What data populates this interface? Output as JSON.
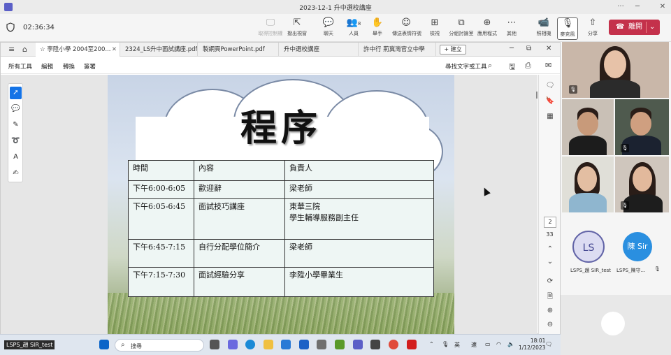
{
  "window": {
    "title": "2023-12-1 升中選校講座",
    "min": "─",
    "restore": "⧉",
    "max": "□",
    "close": "✕"
  },
  "meeting": {
    "timer": "02:36:34",
    "toolbar": [
      {
        "key": "remote_control",
        "label": "取得控制權",
        "icon": "🖵",
        "dim": true
      },
      {
        "key": "stop_present",
        "label": "撥出視窗",
        "icon": "⇱"
      },
      {
        "key": "chat",
        "label": "聊天",
        "icon": "💬"
      },
      {
        "key": "people",
        "label": "人員",
        "icon": "👥",
        "count": "8"
      },
      {
        "key": "raise",
        "label": "舉手",
        "icon": "✋"
      },
      {
        "key": "react",
        "label": "傳送表情符號",
        "icon": "☺"
      },
      {
        "key": "view",
        "label": "檢視",
        "icon": "⊞"
      },
      {
        "key": "rooms",
        "label": "分組討論室",
        "icon": "⧉"
      },
      {
        "key": "apps",
        "label": "應用程式",
        "icon": "⊕"
      },
      {
        "key": "more",
        "label": "其他",
        "icon": "⋯"
      },
      {
        "key": "camera",
        "label": "照相機",
        "icon": "📹"
      },
      {
        "key": "mic",
        "label": "麥克風",
        "icon": "🎙"
      },
      {
        "key": "share",
        "label": "分享",
        "icon": "⇧"
      }
    ],
    "leave_label": "離開"
  },
  "acrobat": {
    "tabs": [
      {
        "label": "李陞小學 2004至200...",
        "active": true
      },
      {
        "label": "2324_LS升中面試講座.pdf"
      },
      {
        "label": "製網頁PowerPoint.pdf"
      },
      {
        "label": "升中選校講座"
      },
      {
        "label": "許中行 荊冀灣官立中學"
      }
    ],
    "new_tab": "+ 建立",
    "menus": [
      "所有工具",
      "編輯",
      "轉換",
      "簽署"
    ],
    "find_label": "尋找文字或工具",
    "page_current": "2",
    "page_total": "33"
  },
  "slide": {
    "title": "程序",
    "headers": [
      "時間",
      "內容",
      "負責人"
    ],
    "rows": [
      {
        "time": "下午6:00-6:05",
        "content": "歡迎辭",
        "owner": "梁老師",
        "owner2": ""
      },
      {
        "time": "下午6:05-6:45",
        "content": "面試技巧講座",
        "owner": "東華三院",
        "owner2": "學生輔導服務副主任"
      },
      {
        "time": "下午6:45-7:15",
        "content": "自行分配學位簡介",
        "owner": "梁老師",
        "owner2": ""
      },
      {
        "time": "下午7:15-7:30",
        "content": "面試經驗分享",
        "owner": "李陞小學畢業生",
        "owner2": ""
      }
    ]
  },
  "participants": {
    "avatars": [
      {
        "initials": "LS",
        "name": "LSPS_趙 SIR_test",
        "bg": "#dcdcf2",
        "fg": "#444791"
      },
      {
        "initials": "陳 Sir",
        "name": "LSPS_陳守...",
        "bg": "#2a8fe0",
        "fg": "#ffffff"
      }
    ]
  },
  "taskbar": {
    "active_name": "LSPS_趙 SIR_test",
    "search_placeholder": "搜尋",
    "ime1": "英",
    "ime2": "速",
    "time": "18:01",
    "date": "1/12/2023"
  }
}
